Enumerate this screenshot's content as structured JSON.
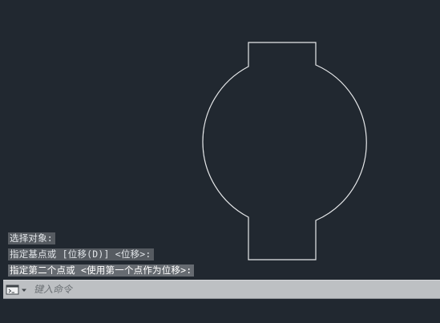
{
  "command_history": [
    "选择对象:",
    "指定基点或 [位移(D)] <位移>:",
    "指定第二个点或 <使用第一个点作为位移>:"
  ],
  "command_line": {
    "placeholder": "键入命令",
    "value": "",
    "icon": "command-prompt-icon"
  },
  "colors": {
    "background": "#212830",
    "geometry_stroke": "#e6e8ea",
    "command_bar": "#bdc0c3"
  }
}
